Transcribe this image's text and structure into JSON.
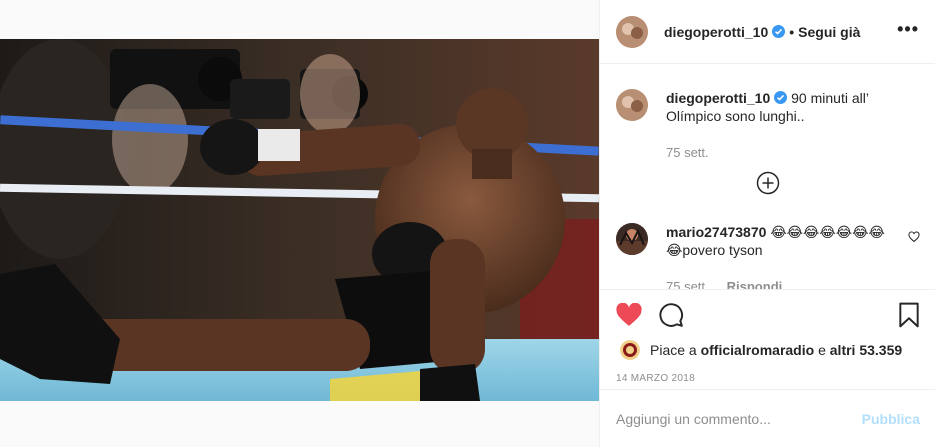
{
  "post": {
    "username": "diegoperotti_10",
    "separator": "•",
    "follow_label": "Segui già",
    "more_label": "•••",
    "caption": {
      "username": "diegoperotti_10",
      "text": "90 minuti all’ Olímpico sono lunghi..",
      "age": "75 sett."
    },
    "comment": {
      "username": "mario27473870",
      "text": "😂😂😂😂😂😂😂😂povero tyson",
      "age": "75 sett.",
      "reply_label": "Rispondi"
    },
    "likes": {
      "prefix": "Piace a",
      "user": "officialromaradio",
      "middle": "e",
      "others": "altri 53.359"
    },
    "date": "14 MARZO 2018",
    "add_comment_placeholder": "Aggiungi un commento...",
    "publish_label": "Pubblica"
  },
  "icons": {
    "verified": "verified-badge-icon",
    "like": "heart-filled-icon",
    "comment": "comment-bubble-icon",
    "save": "bookmark-icon",
    "load_more": "plus-circle-icon",
    "comment_like": "heart-outline-icon"
  },
  "colors": {
    "like_red": "#ed4956",
    "verified_blue": "#3897f0",
    "publish_disabled": "#b2dffc",
    "meta_gray": "#8e8e8e",
    "ring_blue": "#3c6fd1"
  }
}
